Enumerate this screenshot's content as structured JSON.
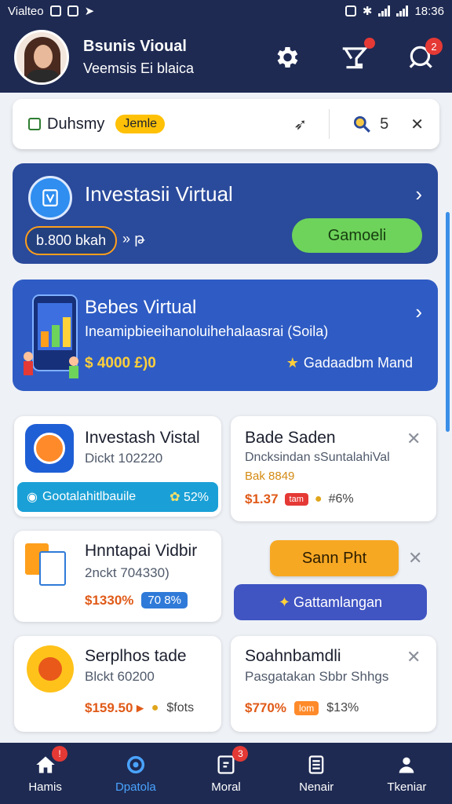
{
  "status_bar": {
    "left_text": "Vialteo",
    "time": "18:36"
  },
  "header": {
    "title": "Bsunis Vioual",
    "subtitle": "Veemsis Ei blaica",
    "notification_badge": "",
    "chat_badge": "2"
  },
  "search": {
    "brand": "Duhsmy",
    "chip": "Jemle",
    "count": "5"
  },
  "banner_invest": {
    "title": "Investasii Virtual",
    "pill": "b.800 bkah",
    "amount": "» թ",
    "button": "Gamoeli"
  },
  "banner_promo": {
    "title": "Bebes Virtual",
    "subtitle": "Ineamipbieeihanoluihehalaasrai (Soila)",
    "price": "$ 4000 £)0",
    "rating_label": "Gadaadbm Mand"
  },
  "cards": [
    {
      "title": "Investash Vistal",
      "sub": "Dickt 102220",
      "bar_left": "Gootalahitlbauile",
      "bar_right": "52%"
    },
    {
      "title": "Bade Saden",
      "sub": "Dncksindan sSuntalahiVal",
      "sub2": "Bak 8849",
      "price": "$1.37",
      "tag": "tam",
      "pct": "#6%"
    },
    {
      "title": "Hnntapai Vidbir",
      "sub": "2nckt 704330)",
      "price": "$1330%",
      "tag": "70 8%"
    },
    {
      "title": "Serplhos tade",
      "sub": "Blckt 60200",
      "price": "$159.50 ▸",
      "pct": "$fots"
    },
    {
      "title": "Soahnbamdli",
      "sub": "Pasgatakan Sbbr Shhgs",
      "price": "$770%",
      "tag": "lom",
      "pct": "$13%"
    }
  ],
  "actions": {
    "orange_button": "Sann Pht",
    "indigo_button": "Gattamlangan"
  },
  "bottom_nav": [
    {
      "label": "Hamis",
      "badge": "!"
    },
    {
      "label": "Dpatola",
      "badge": ""
    },
    {
      "label": "Moral",
      "badge": "3"
    },
    {
      "label": "Nenair",
      "badge": ""
    },
    {
      "label": "Tkeniar",
      "badge": ""
    }
  ],
  "colors": {
    "header_bg": "#1e2a52",
    "accent_green": "#6ed35a",
    "accent_orange": "#f7a823",
    "price_orange": "#e05a18"
  }
}
